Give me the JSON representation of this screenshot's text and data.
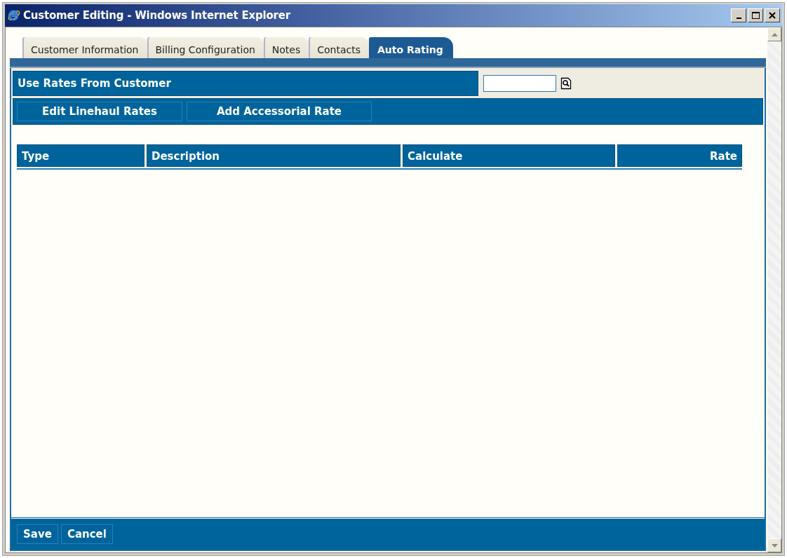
{
  "window": {
    "title": "Customer Editing - Windows Internet Explorer"
  },
  "tabs": [
    {
      "label": "Customer Information",
      "selected": false
    },
    {
      "label": "Billing Configuration",
      "selected": false
    },
    {
      "label": "Notes",
      "selected": false
    },
    {
      "label": "Contacts",
      "selected": false
    },
    {
      "label": "Auto Rating",
      "selected": true
    }
  ],
  "use_rates": {
    "label": "Use Rates From Customer"
  },
  "actions": [
    "Edit Linehaul Rates",
    "Add Accessorial Rate"
  ],
  "table": {
    "columns": [
      {
        "label": "Type"
      },
      {
        "label": "Description"
      },
      {
        "label": "Calculate"
      },
      {
        "label": "Rate"
      }
    ]
  },
  "footer_buttons": [
    "Save",
    "Cancel"
  ]
}
